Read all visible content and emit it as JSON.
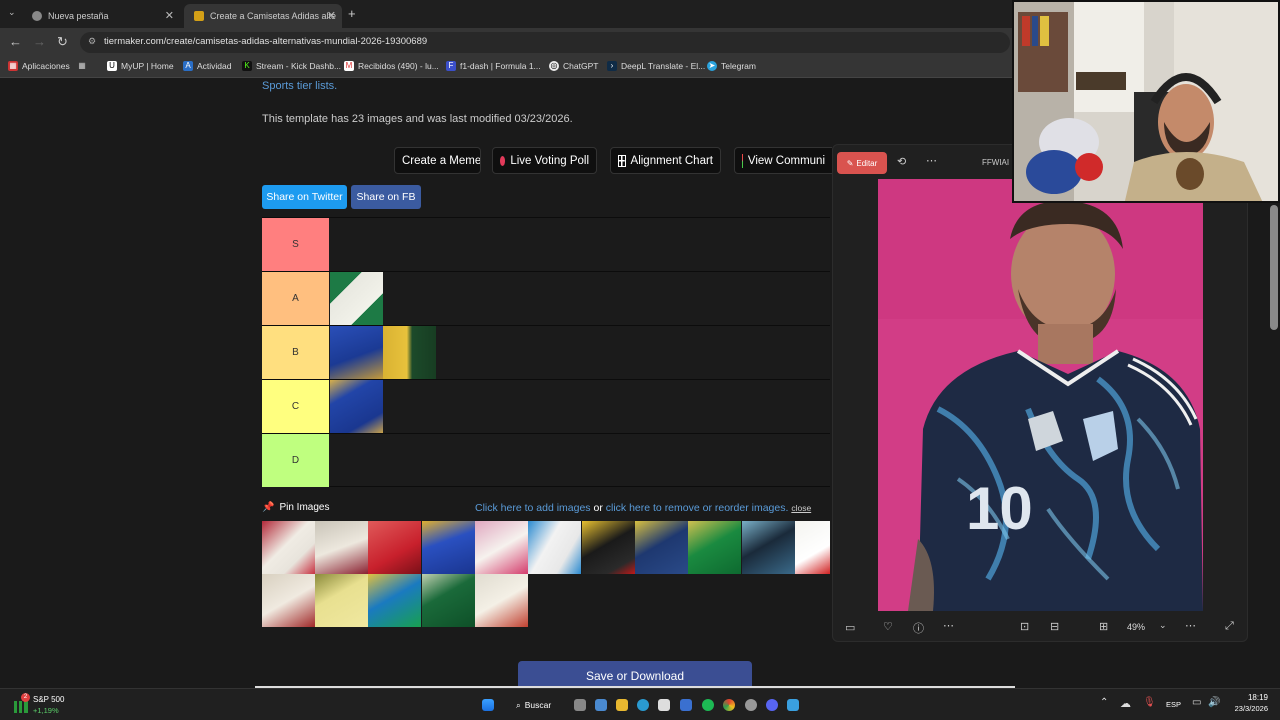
{
  "browser": {
    "tabs": [
      {
        "label": "Nueva pestaña"
      },
      {
        "label": "Create a Camisetas Adidas alte"
      }
    ],
    "url": "tiermaker.com/create/camisetas-adidas-alternativas-mundial-2026-19300689",
    "bookmarks": [
      "Aplicaciones",
      "MyUP | Home",
      "Actividad",
      "Stream - Kick Dashb...",
      "Recibidos (490) - lu...",
      "f1-dash | Formula 1...",
      "ChatGPT",
      "DeepL Translate - El...",
      "Telegram"
    ]
  },
  "page": {
    "sports_link": "Sports tier lists.",
    "template_info": "This template has 23 images and was last modified 03/23/2026.",
    "buttons": {
      "create_meme": "Create a Meme",
      "live_voting": "Live Voting Poll",
      "alignment": "Alignment Chart",
      "view_community": "View Communi"
    },
    "share": {
      "twitter": "Share on Twitter",
      "fb": "Share on FB"
    },
    "tiers": [
      {
        "label": "S",
        "color": "#ff7f7f"
      },
      {
        "label": "A",
        "color": "#ffbf7f"
      },
      {
        "label": "B",
        "color": "#ffdf7f"
      },
      {
        "label": "C",
        "color": "#ffff7f"
      },
      {
        "label": "D",
        "color": "#bfff7f"
      }
    ],
    "pin_images": "Pin Images",
    "add_images": "Click here to add images",
    "or": "or",
    "remove_images": "click here to remove or reorder images.",
    "close": "close",
    "save": "Save or Download"
  },
  "viewer": {
    "edit": "Editar",
    "filename_fragment": "FFWIAI",
    "zoom": "49%"
  },
  "taskbar": {
    "stock_name": "S&P 500",
    "stock_change": "+1,19%",
    "badge": "2",
    "search": "Buscar",
    "lang": "ESP",
    "time": "18:19",
    "date": "23/3/2026"
  }
}
